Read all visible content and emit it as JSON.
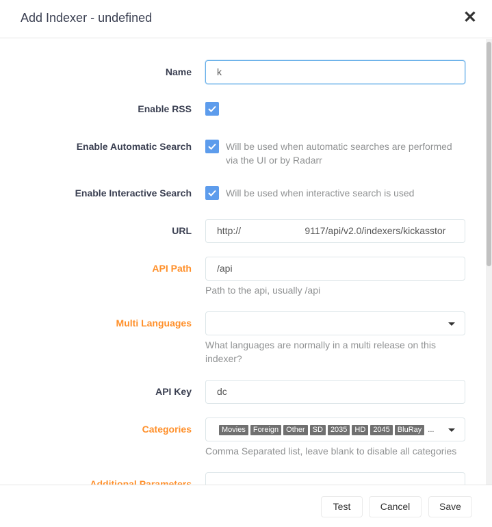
{
  "modal": {
    "title": "Add Indexer - undefined"
  },
  "form": {
    "name": {
      "label": "Name",
      "value": "k"
    },
    "enable_rss": {
      "label": "Enable RSS",
      "checked": true
    },
    "enable_automatic_search": {
      "label": "Enable Automatic Search",
      "checked": true,
      "help_line1": "Will be used when automatic searches are performed",
      "help_line2": "via the UI or by Radarr"
    },
    "enable_interactive_search": {
      "label": "Enable Interactive Search",
      "checked": true,
      "help": "Will be used when interactive search is used"
    },
    "url": {
      "label": "URL",
      "value": "http://                        9117/api/v2.0/indexers/kickasstor"
    },
    "api_path": {
      "label": "API Path",
      "value": "/api",
      "help": "Path to the api, usually /api"
    },
    "multi_languages": {
      "label": "Multi Languages",
      "value": "",
      "help_line1": "What languages are normally in a multi release on this",
      "help_line2": "indexer?"
    },
    "api_key": {
      "label": "API Key",
      "value": "dc"
    },
    "categories": {
      "label": "Categories",
      "tags": [
        "Movies",
        "Foreign",
        "Other",
        "SD",
        "2035",
        "HD",
        "2045",
        "BluRay"
      ],
      "overflow": "...",
      "help": "Comma Separated list, leave blank to disable all categories"
    },
    "additional_parameters": {
      "label": "Additional Parameters",
      "value": ""
    }
  },
  "footer": {
    "test": "Test",
    "cancel": "Cancel",
    "save": "Save"
  },
  "colors": {
    "accent": "#5d9cec",
    "advanced_label": "#ff902b",
    "label": "#3a3f51"
  }
}
